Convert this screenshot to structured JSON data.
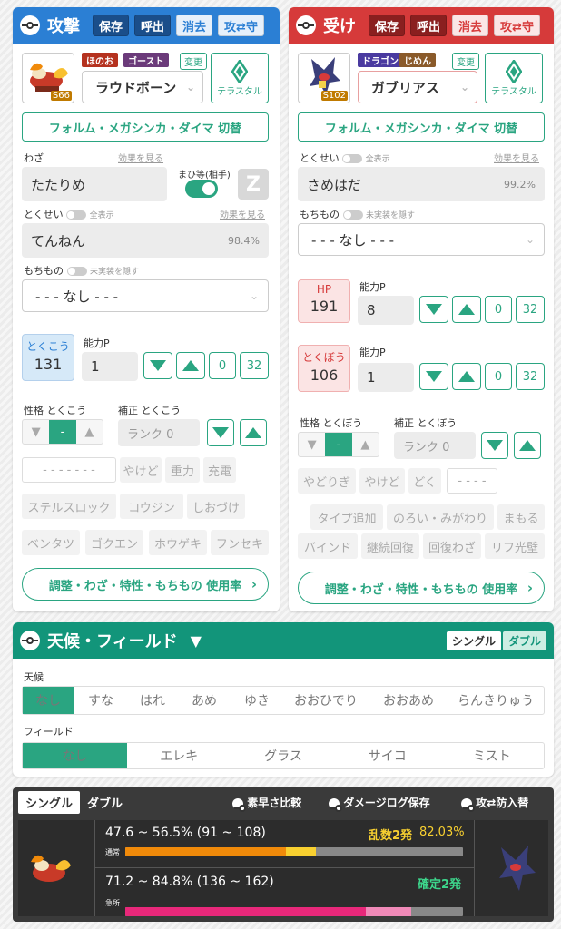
{
  "colors": {
    "attack": "#2b7fd4",
    "defense": "#d63a3a",
    "accent": "#2aa581",
    "dark": "#333333",
    "orange": "#f08a0a",
    "yellow": "#f8d030",
    "pink": "#e8287a",
    "lightpink": "#f08ab8"
  },
  "attack": {
    "title": "攻撃",
    "save": "保存",
    "load": "呼出",
    "clear": "消去",
    "swap": "攻⇄守",
    "types": [
      "ほのお",
      "ゴースト"
    ],
    "change": "変更",
    "pokemon": "ラウドボーン",
    "level_badge": "S66",
    "terastal": "テラスタル",
    "form_toggle": "フォルム・メガシンカ・ダイマ 切替",
    "move_label": "わざ",
    "move_effect": "効果を見る",
    "move": "たたりめ",
    "mahi_label": "まひ等(相手)",
    "z_label": "Z",
    "ability_label": "とくせい",
    "ability_all": "全表示",
    "ability_effect": "効果を見る",
    "ability": "てんねん",
    "ability_rate": "98.4%",
    "item_label": "もちもの",
    "item_hide": "未実装を隠す",
    "item": "- - - なし - - -",
    "stat_label": "とくこう",
    "stat_value": "131",
    "ability_p_label": "能力P",
    "ability_p": "1",
    "zero": "0",
    "max": "32",
    "nature_label": "性格 とくこう",
    "nature_mid": "-",
    "correction_label": "補正 とくこう",
    "rank": "ランク 0",
    "chips_row1": [
      "- - - - - - -",
      "やけど",
      "重力",
      "充電"
    ],
    "chips_row2": [
      "ステルスロック",
      "コウジン",
      "しおづけ"
    ],
    "chips_row3": [
      "ベンタツ",
      "ゴクエン",
      "ホウゲキ",
      "フンセキ"
    ],
    "usage_btn": "調整・わざ・特性・もちもの 使用率"
  },
  "defense": {
    "title": "受け",
    "save": "保存",
    "load": "呼出",
    "clear": "消去",
    "swap": "攻⇄守",
    "types": [
      "ドラゴン",
      "じめん"
    ],
    "change": "変更",
    "pokemon": "ガブリアス",
    "level_badge": "S102",
    "terastal": "テラスタル",
    "form_toggle": "フォルム・メガシンカ・ダイマ 切替",
    "ability_label": "とくせい",
    "ability_all": "全表示",
    "ability_effect": "効果を見る",
    "ability": "さめはだ",
    "ability_rate": "99.2%",
    "item_label": "もちもの",
    "item_hide": "未実装を隠す",
    "item": "- - - なし - - -",
    "hp_label": "HP",
    "hp_value": "191",
    "hp_p_label": "能力P",
    "hp_p": "8",
    "stat_label": "とくぼう",
    "stat_value": "106",
    "stat_p_label": "能力P",
    "stat_p": "1",
    "zero": "0",
    "max": "32",
    "nature_label": "性格 とくぼう",
    "nature_mid": "-",
    "correction_label": "補正 とくぼう",
    "rank": "ランク 0",
    "chips_row1": [
      "やどりぎ",
      "やけど",
      "どく",
      "- - - -"
    ],
    "chips_row2": [
      "タイプ追加",
      "のろい・みがわり",
      "まもる"
    ],
    "chips_row3": [
      "バインド",
      "継続回復",
      "回復わざ",
      "リフ光壁"
    ],
    "usage_btn": "調整・わざ・特性・もちもの 使用率"
  },
  "field": {
    "title": "天候・フィールド",
    "single": "シングル",
    "double": "ダブル",
    "weather_label": "天候",
    "weather": [
      "なし",
      "すな",
      "はれ",
      "あめ",
      "ゆき",
      "おおひでり",
      "おおあめ",
      "らんきりゅう"
    ],
    "field_label": "フィールド",
    "fields": [
      "なし",
      "エレキ",
      "グラス",
      "サイコ",
      "ミスト"
    ]
  },
  "result": {
    "tab_single": "シングル",
    "tab_double": "ダブル",
    "speed": "素早さ比較",
    "log": "ダメージログ保存",
    "swap": "攻⇄防入替",
    "normal_range": "47.6 ~ 56.5% (91 ~ 108)",
    "normal_tag": "通常",
    "normal_verdict": "乱数2発",
    "normal_pct": "82.03%",
    "crit_range": "71.2 ~ 84.8% (136 ~ 162)",
    "crit_tag": "急所",
    "crit_verdict": "確定2発",
    "normal_bar": {
      "min_pct": 47.6,
      "max_pct": 56.5
    },
    "crit_bar": {
      "min_pct": 71.2,
      "max_pct": 84.8
    }
  }
}
